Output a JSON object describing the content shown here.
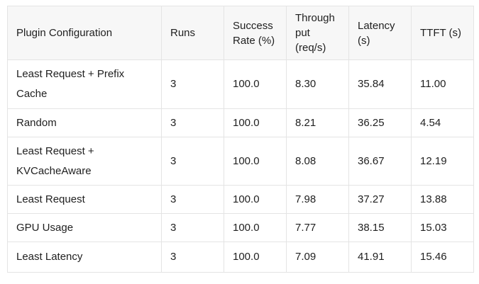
{
  "table": {
    "headers": [
      [
        "Plugin Configuration"
      ],
      [
        "Runs"
      ],
      [
        "Success",
        "Rate (%)"
      ],
      [
        "Through",
        "put",
        "(req/s)"
      ],
      [
        "Latency",
        "(s)"
      ],
      [
        "TTFT (s)"
      ]
    ],
    "rows": [
      [
        "Least Request + Prefix Cache",
        "3",
        "100.0",
        "8.30",
        "35.84",
        "11.00"
      ],
      [
        "Random",
        "3",
        "100.0",
        "8.21",
        "36.25",
        "4.54"
      ],
      [
        "Least Request + KVCacheAware",
        "3",
        "100.0",
        "8.08",
        "36.67",
        "12.19"
      ],
      [
        "Least Request",
        "3",
        "100.0",
        "7.98",
        "37.27",
        "13.88"
      ],
      [
        "GPU Usage",
        "3",
        "100.0",
        "7.77",
        "38.15",
        "15.03"
      ],
      [
        "Least Latency",
        "3",
        "100.0",
        "7.09",
        "41.91",
        "15.46"
      ]
    ]
  }
}
